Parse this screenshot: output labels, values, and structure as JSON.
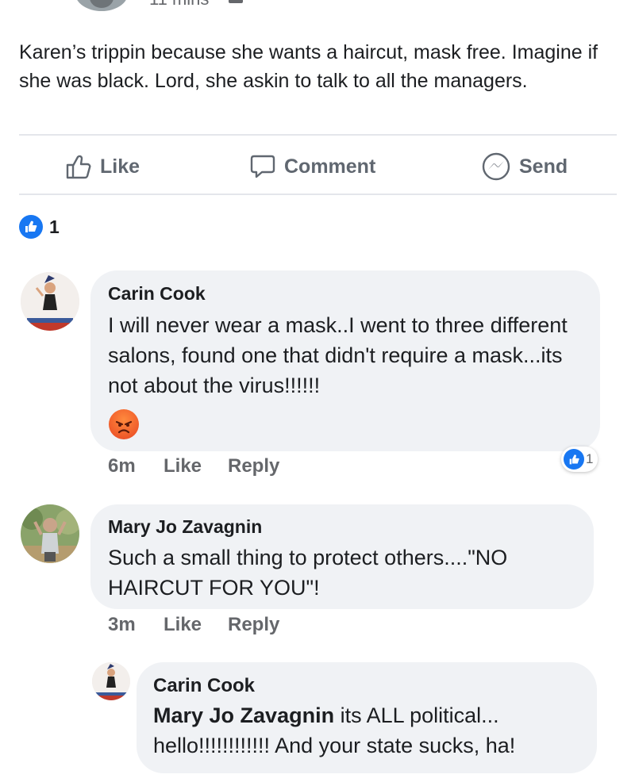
{
  "header": {
    "time": "11 mins"
  },
  "post": {
    "text": "Karen’s trippin because she wants a haircut, mask free. Imagine if she was black.  Lord, she askin to talk to all the managers."
  },
  "actions": {
    "like": "Like",
    "comment": "Comment",
    "send": "Send"
  },
  "reactions": {
    "count": "1"
  },
  "comments": [
    {
      "name": "Carin Cook",
      "text": "I will never wear a mask..I went to three different salons, found one that didn't require a mask...its not about  the virus!!!!!!",
      "time": "6m",
      "like": "Like",
      "reply": "Reply",
      "reaction_count": "1"
    },
    {
      "name": "Mary Jo Zavagnin",
      "text": "Such a small thing to protect others....\"NO HAIRCUT FOR YOU\"!",
      "time": "3m",
      "like": "Like",
      "reply": "Reply"
    }
  ],
  "reply": {
    "name": "Carin Cook",
    "mention": "Mary Jo Zavagnin",
    "text": " its ALL political... hello!!!!!!!!!!!! And your state sucks, ha!"
  },
  "colors": {
    "brand_blue": "#1877f2",
    "bubble": "#f0f2f5",
    "meta_gray": "#65676b",
    "angry": "#ef5a2a"
  },
  "icons": [
    "like-icon",
    "comment-icon",
    "messenger-icon",
    "angry-reaction-icon"
  ]
}
